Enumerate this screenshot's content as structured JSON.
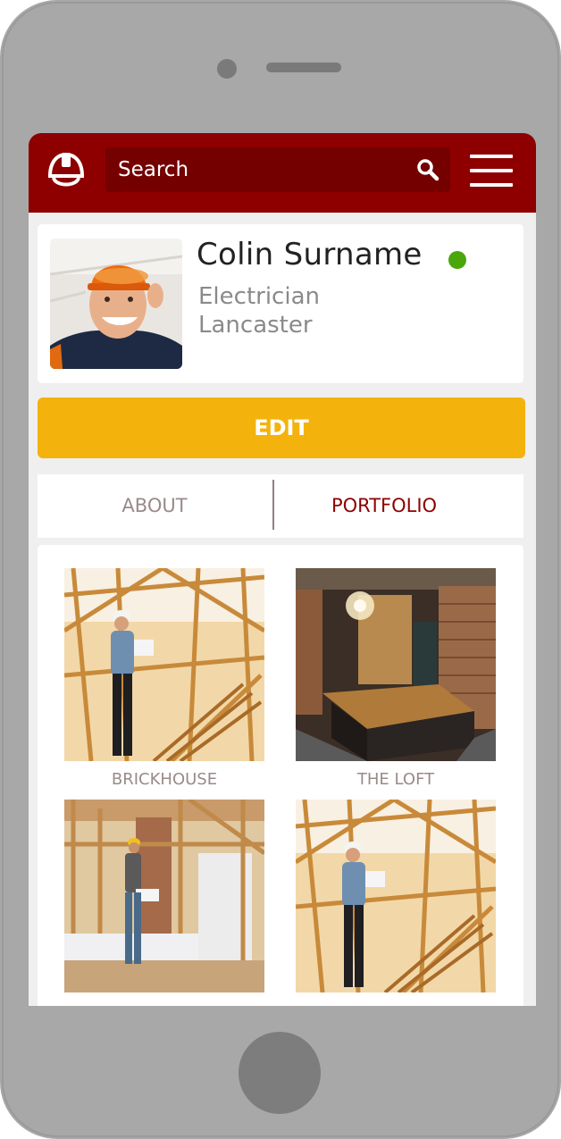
{
  "header": {
    "logo_icon": "hardhat-icon",
    "search_placeholder": "Search",
    "search_icon": "search-icon",
    "menu_icon": "hamburger-menu-icon",
    "bar_color": "#8e0000"
  },
  "profile": {
    "name": "Colin Surname",
    "trade": "Electrician",
    "location": "Lancaster",
    "status": "online",
    "status_color": "#4aa60a"
  },
  "actions": {
    "edit_label": "EDIT",
    "edit_color": "#f4b20c"
  },
  "tabs": [
    {
      "label": "ABOUT",
      "active": false
    },
    {
      "label": "PORTFOLIO",
      "active": true
    }
  ],
  "portfolio": {
    "items": [
      {
        "caption": "BRICKHOUSE"
      },
      {
        "caption": "THE LOFT"
      },
      {
        "caption": ""
      },
      {
        "caption": ""
      }
    ]
  }
}
